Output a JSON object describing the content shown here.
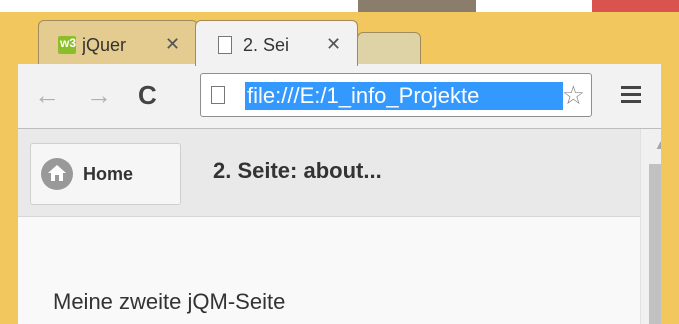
{
  "tabs": [
    {
      "title": "jQuer",
      "icon": "w3schools-icon",
      "icon_text": "w3",
      "close": "✕"
    },
    {
      "title": "2. Sei",
      "icon": "page-icon",
      "close": "✕"
    }
  ],
  "toolbar": {
    "back": "←",
    "forward": "→",
    "reload": "C",
    "url": "file:///E:/1_info_Projekte",
    "star": "☆"
  },
  "page": {
    "home_label": "Home",
    "title": "2. Seite: about...",
    "body": "Meine zweite jQM-Seite"
  },
  "colors": {
    "frame": "#f2c85e",
    "url_highlight": "#3399ff",
    "w3_green": "#8cbe2b"
  }
}
